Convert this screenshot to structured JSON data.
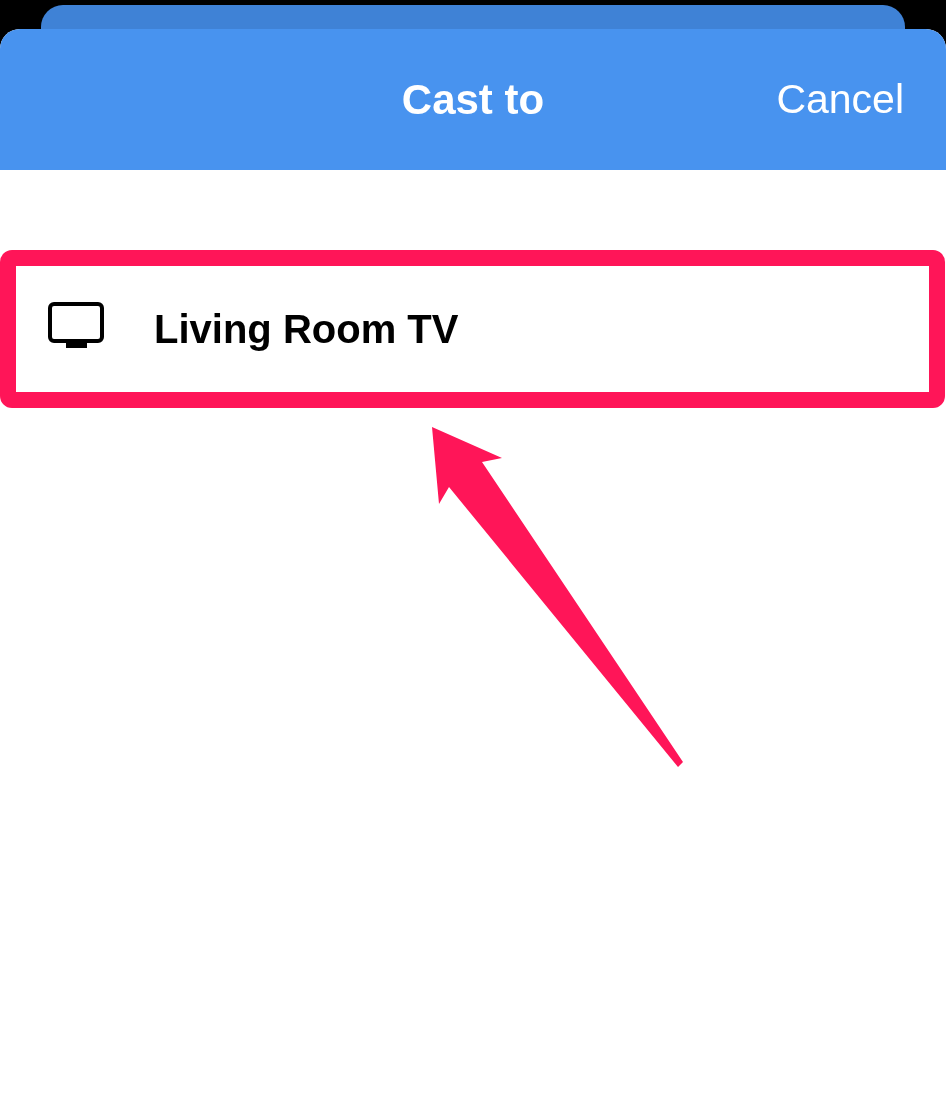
{
  "sheet": {
    "title": "Cast to",
    "cancel_label": "Cancel"
  },
  "devices": [
    {
      "kind": "tv",
      "name": "Living Room TV",
      "highlighted": true
    }
  ]
}
